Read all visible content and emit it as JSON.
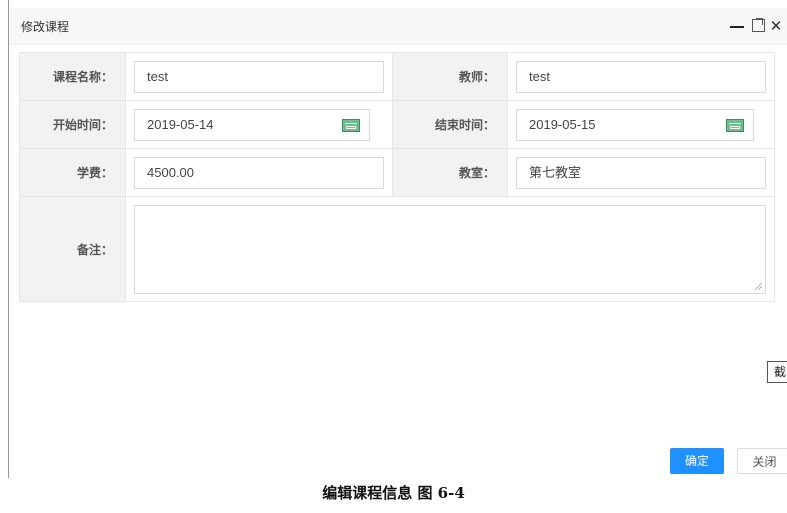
{
  "dialog": {
    "title": "修改课程",
    "controls": {
      "minimize": "—",
      "maximize": "",
      "close": "✕"
    }
  },
  "form": {
    "course_name": {
      "label": "课程名称：",
      "value": "test"
    },
    "teacher": {
      "label": "教师：",
      "value": "test"
    },
    "start_time": {
      "label": "开始时间：",
      "value": "2019-05-14"
    },
    "end_time": {
      "label": "结束时间：",
      "value": "2019-05-15"
    },
    "tuition": {
      "label": "学费：",
      "value": "4500.00"
    },
    "classroom": {
      "label": "教室：",
      "value": "第七教室"
    },
    "remark": {
      "label": "备注：",
      "value": ""
    }
  },
  "side_button": {
    "label": "截"
  },
  "buttons": {
    "confirm": "确定",
    "close": "关闭"
  },
  "caption": "编辑课程信息 图 6-4",
  "colors": {
    "primary": "#1e90ff",
    "label_bg": "#f2f2f2",
    "titlebar_bg": "#f7f7f7"
  }
}
